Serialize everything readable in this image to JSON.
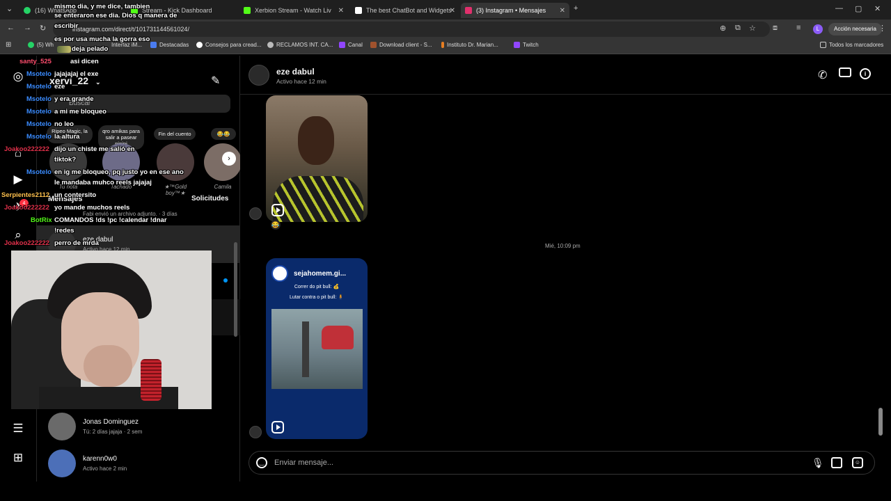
{
  "browser": {
    "tabs": [
      {
        "label": "(16) WhatsApp",
        "color": "#25D366"
      },
      {
        "label": "Stream - Kick Dashboard",
        "color": "#53fc18"
      },
      {
        "label": "Xerbion Stream - Watch Liv",
        "color": "#53fc18"
      },
      {
        "label": "The best ChatBot and Widgets",
        "color": "#ffffff"
      },
      {
        "label": "(3) Instagram • Mensajes",
        "color": "#e1306c"
      }
    ],
    "url": "instagram.com/direct/t/101731144561024/",
    "action_button": "Acción necesaria",
    "profile_letter": "L",
    "bookmarks": [
      {
        "label": "(5) Wh"
      },
      {
        "label": "Interfaz iM..."
      },
      {
        "label": "Destacadas"
      },
      {
        "label": "Consejos para cread..."
      },
      {
        "label": "RECLAMOS INT. CA..."
      },
      {
        "label": "Canal"
      },
      {
        "label": "Download client - S..."
      },
      {
        "label": "Instituto Dr. Marian..."
      },
      {
        "label": "Twitch"
      }
    ],
    "all_bookmarks": "Todos los marcadores"
  },
  "instagram": {
    "username": "xervi_22",
    "search_placeholder": "Buscar",
    "notes": [
      {
        "text": "Ripeo Magic, la altura da"
      },
      {
        "text": "qro amikas para salir a pasear pipipi"
      },
      {
        "text": "Fin del cuento"
      },
      {
        "text": "😂😂"
      }
    ],
    "stories": [
      {
        "name": "Tu nota"
      },
      {
        "name": "Tachado"
      },
      {
        "name": "★™Gold boy™★"
      },
      {
        "name": "Camila"
      }
    ],
    "section_messages": "Mensajes",
    "section_requests": "Solicitudes",
    "notif_count": "4",
    "conversations": [
      {
        "name": "Fabi envió un archivo adjunto. · 3 días",
        "sub": ""
      },
      {
        "name": "eze dabul",
        "sub": "Activo hace 12 min"
      },
      {
        "name": "Jonas Dominguez",
        "sub": "Tú: 2 días jajaja · 2 sem"
      },
      {
        "name": "karenn0w0",
        "sub": "Activo hace 2 min"
      }
    ],
    "chat": {
      "name": "eze dabul",
      "status": "Activo hace 12 min",
      "timestamp": "Mié, 10:09 pm",
      "reel_title": "sejahomem.gi...",
      "reel_line1": "Correr do pit bull: 💰",
      "reel_line2": "Lutar contra o pit bull: 🧍",
      "input_placeholder": "Enviar mensaje..."
    }
  },
  "stream_chat": [
    {
      "user": "",
      "text": "mismo dia, y me dice, tambien"
    },
    {
      "user": "",
      "text": "se enteraron ese dia. Dios q manera de"
    },
    {
      "user": "",
      "text": "escribir"
    },
    {
      "user": "",
      "text": "es por usa mucha la gorra eso"
    },
    {
      "user": "",
      "text": "deja pelado"
    },
    {
      "user": "santy_525",
      "text": "asi dicen"
    },
    {
      "user": "Msotelo",
      "text": "jajajajaj el exe"
    },
    {
      "user": "Msotelo",
      "text": "eze"
    },
    {
      "user": "Msotelo",
      "text": "y era grande"
    },
    {
      "user": "Msotelo",
      "text": "a mi me bloqueo"
    },
    {
      "user": "Msotelo",
      "text": "no leo"
    },
    {
      "user": "Msotelo",
      "text": "la altura"
    },
    {
      "user": "Joakoo222222",
      "text": "dijo un chiste me salió en"
    },
    {
      "user": "",
      "text": "tiktok?"
    },
    {
      "user": "Msotelo",
      "text": "en ig me bloqueo, pq justo yo en ese ano"
    },
    {
      "user": "",
      "text": "le mandaba muhco reels jajajaj"
    },
    {
      "user": "Serpientes2112",
      "text": "un contersito"
    },
    {
      "user": "Joakoo222222",
      "text": "yo mande muchos reels"
    },
    {
      "user": "BotRix",
      "text": "COMANDOS !ds !pc !calendar !dnar"
    },
    {
      "user": "",
      "text": "!redes"
    },
    {
      "user": "Joakoo222222",
      "text": "perro de mrda"
    }
  ]
}
